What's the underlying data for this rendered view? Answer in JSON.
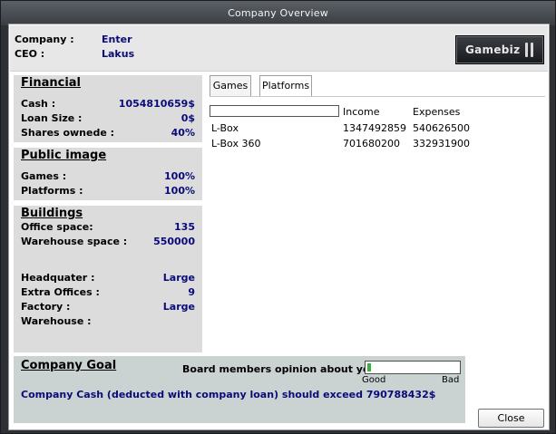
{
  "window": {
    "title": "Company Overview"
  },
  "header": {
    "company_label": "Company :",
    "company_value": "Enter",
    "ceo_label": "CEO :",
    "ceo_value": "Lakus",
    "logo_text": "Gamebiz"
  },
  "financial": {
    "title": "Financial",
    "rows": [
      {
        "label": "Cash :",
        "value": "1054810659$"
      },
      {
        "label": "Loan Size :",
        "value": "0$"
      },
      {
        "label": "Shares ownede :",
        "value": "40%"
      }
    ]
  },
  "public_image": {
    "title": "Public image",
    "rows": [
      {
        "label": "Games :",
        "value": "100%"
      },
      {
        "label": "Platforms :",
        "value": "100%"
      }
    ]
  },
  "buildings": {
    "title": "Buildings",
    "rows": [
      {
        "label": "Office space:",
        "value": "135"
      },
      {
        "label": "Warehouse space :",
        "value": "550000"
      },
      {
        "label": "Headquater :",
        "value": "Large"
      },
      {
        "label": "Extra Offices :",
        "value": "9"
      },
      {
        "label": "Factory :",
        "value": "Large"
      },
      {
        "label": "Warehouse :",
        "value": ""
      }
    ]
  },
  "tabs": [
    {
      "label": "Games",
      "active": false
    },
    {
      "label": "Platforms",
      "active": true
    }
  ],
  "platforms_table": {
    "filter_value": "",
    "columns": [
      "",
      "Income",
      "Expenses"
    ],
    "rows": [
      {
        "name": "L-Box",
        "income": "1347492859",
        "expenses": "540626500"
      },
      {
        "name": "L-Box 360",
        "income": "701680200",
        "expenses": "332931900"
      }
    ]
  },
  "goal": {
    "title": "Company Goal",
    "opinion_label": "Board members opinion about you :",
    "opinion_fraction": 0.04,
    "good_label": "Good",
    "bad_label": "Bad",
    "text": "Company Cash (deducted with company loan) should exceed 790788432$"
  },
  "buttons": {
    "close_label": "Close"
  },
  "colors": {
    "value_text": "#0a0a7a",
    "panel_bg": "#dcdcdc",
    "goal_bg": "#cbd2d2",
    "opinion_fill": "#3fae3f"
  }
}
